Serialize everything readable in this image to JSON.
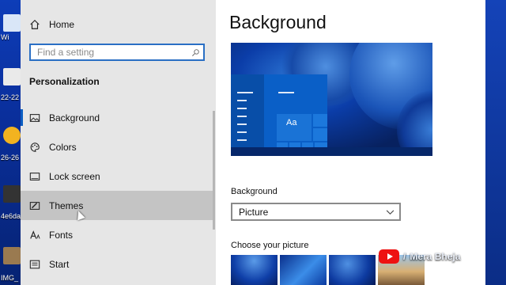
{
  "desktop": {
    "labels": [
      "Wi",
      "22-22",
      "26-26",
      "4e6da",
      "IMG_"
    ]
  },
  "sidebar": {
    "home_label": "Home",
    "search_placeholder": "Find a setting",
    "section_title": "Personalization",
    "items": [
      {
        "label": "Background",
        "icon": "picture-icon"
      },
      {
        "label": "Colors",
        "icon": "palette-icon"
      },
      {
        "label": "Lock screen",
        "icon": "lock-screen-icon"
      },
      {
        "label": "Themes",
        "icon": "paintbrush-icon"
      },
      {
        "label": "Fonts",
        "icon": "font-icon"
      },
      {
        "label": "Start",
        "icon": "start-icon"
      }
    ]
  },
  "content": {
    "title": "Background",
    "preview_text": "Aa",
    "background_label": "Background",
    "background_value": "Picture",
    "choose_label": "Choose your picture"
  },
  "watermark": {
    "text": "Mera Bheja",
    "separator": "/"
  },
  "colors": {
    "accent": "#0a5dc2",
    "sidebar_bg": "#e6e6e6",
    "hover_bg": "#c4c4c4"
  }
}
